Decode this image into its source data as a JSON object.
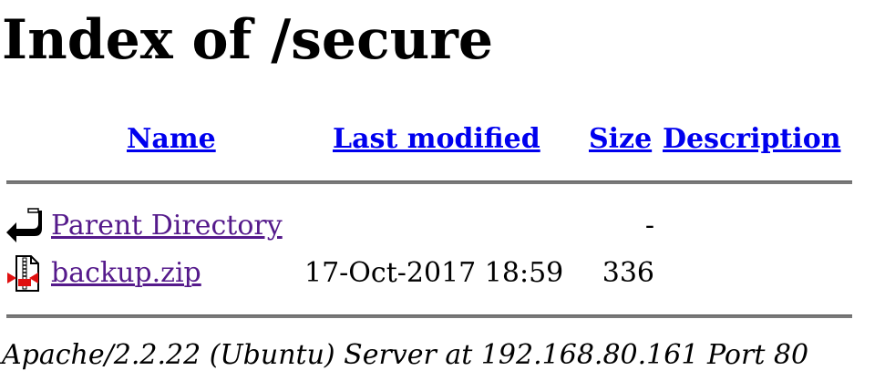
{
  "title": "Index of /secure",
  "columns": {
    "name": "Name",
    "last_modified": "Last modified",
    "size": "Size",
    "description": "Description"
  },
  "rows": [
    {
      "icon": "back-arrow-icon",
      "name": "Parent Directory",
      "modified": "",
      "size": "-"
    },
    {
      "icon": "compressed-file-icon",
      "name": "backup.zip",
      "modified": "17-Oct-2017 18:59",
      "size": "336"
    }
  ],
  "footer": "Apache/2.2.22 (Ubuntu) Server at 192.168.80.161 Port 80",
  "colors": {
    "link": "#0000ee",
    "visited_link": "#551a8b"
  }
}
